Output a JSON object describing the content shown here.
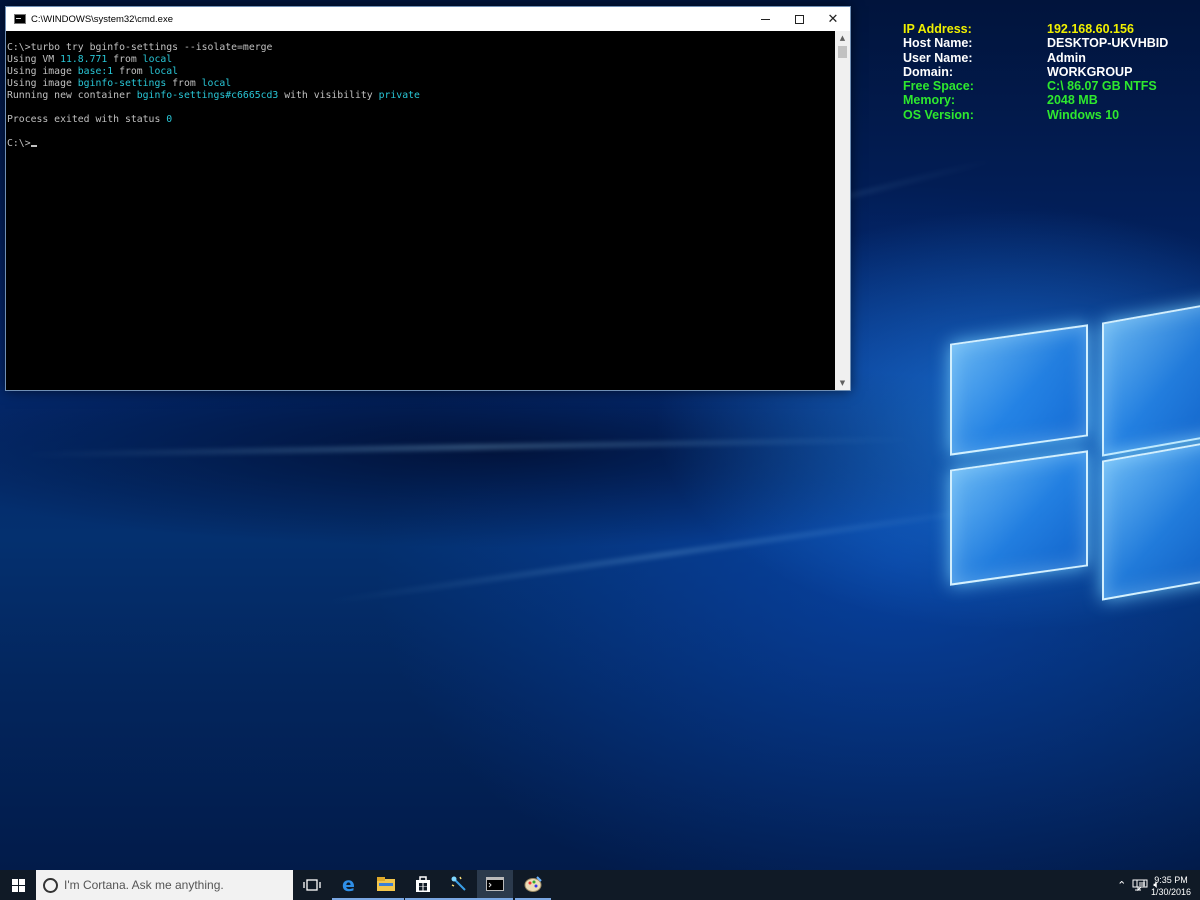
{
  "colors": {
    "console_bg": "#000000",
    "console_text": "#c0c0c0",
    "console_highlight": "#29c6d6",
    "bginfo_yellow": "#f0f000",
    "bginfo_white": "#ffffff",
    "bginfo_green": "#2ee82e",
    "taskbar_bg": "#101a26"
  },
  "cmd": {
    "title": "C:\\WINDOWS\\system32\\cmd.exe",
    "lines": [
      {
        "segments": [
          {
            "text": "C:\\>turbo try bginfo-settings --isolate=merge",
            "hl": false
          }
        ]
      },
      {
        "segments": [
          {
            "text": "Using VM ",
            "hl": false
          },
          {
            "text": "11.8.771",
            "hl": true
          },
          {
            "text": " from ",
            "hl": false
          },
          {
            "text": "local",
            "hl": true
          }
        ]
      },
      {
        "segments": [
          {
            "text": "Using image ",
            "hl": false
          },
          {
            "text": "base:1",
            "hl": true
          },
          {
            "text": " from ",
            "hl": false
          },
          {
            "text": "local",
            "hl": true
          }
        ]
      },
      {
        "segments": [
          {
            "text": "Using image ",
            "hl": false
          },
          {
            "text": "bginfo-settings",
            "hl": true
          },
          {
            "text": " from ",
            "hl": false
          },
          {
            "text": "local",
            "hl": true
          }
        ]
      },
      {
        "segments": [
          {
            "text": "Running new container ",
            "hl": false
          },
          {
            "text": "bginfo-settings#c6665cd3",
            "hl": true
          },
          {
            "text": " with visibility ",
            "hl": false
          },
          {
            "text": "private",
            "hl": true
          }
        ]
      },
      {
        "segments": [
          {
            "text": "",
            "hl": false
          }
        ]
      },
      {
        "segments": [
          {
            "text": "Process exited with status ",
            "hl": false
          },
          {
            "text": "0",
            "hl": true
          }
        ]
      },
      {
        "segments": [
          {
            "text": "",
            "hl": false
          }
        ]
      },
      {
        "segments": [
          {
            "text": "C:\\>",
            "hl": false
          }
        ],
        "cursor": true
      }
    ]
  },
  "bginfo": [
    {
      "key": "IP Address:",
      "value": "192.168.60.156",
      "color": "yellow"
    },
    {
      "key": "Host Name:",
      "value": "DESKTOP-UKVHBID",
      "color": "white"
    },
    {
      "key": "User Name:",
      "value": "Admin",
      "color": "white"
    },
    {
      "key": "Domain:",
      "value": "WORKGROUP",
      "color": "white"
    },
    {
      "key": "Free Space:",
      "value": "C:\\ 86.07 GB NTFS",
      "color": "green"
    },
    {
      "key": "Memory:",
      "value": "2048 MB",
      "color": "green"
    },
    {
      "key": "OS Version:",
      "value": "Windows 10",
      "color": "green"
    }
  ],
  "taskbar": {
    "search_placeholder": "I'm Cortana. Ask me anything.",
    "apps": [
      {
        "name": "task-view-icon"
      },
      {
        "name": "edge-icon"
      },
      {
        "name": "file-explorer-icon"
      },
      {
        "name": "store-icon"
      },
      {
        "name": "magic-wand-app-icon"
      },
      {
        "name": "command-prompt-icon"
      },
      {
        "name": "paint-app-icon"
      }
    ],
    "time": "9:35 PM",
    "date": "1/30/2016"
  }
}
